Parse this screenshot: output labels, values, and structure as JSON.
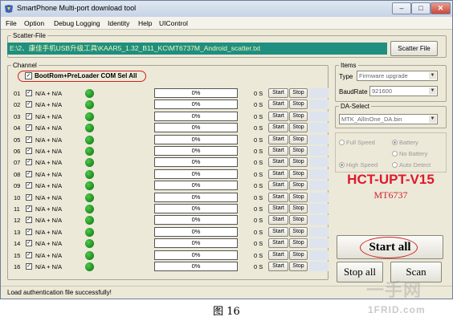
{
  "window": {
    "title": "SmartPhone Multi-port download tool",
    "minimize": "–",
    "maximize": "□",
    "close": "✕"
  },
  "menu": [
    "File",
    "Option",
    "Debug Logging",
    "Identity",
    "Help",
    "UIControl"
  ],
  "scatter": {
    "legend": "Scatter-File",
    "path": "E:\\2、康佳手机USB升级工具\\KAAR5_1.32_B11_KC\\MT6737M_Android_scatter.txt",
    "button": "Scatter File"
  },
  "channel": {
    "legend": "Channel",
    "bootrom_label": "BootRom+PreLoader COM Sel All",
    "bootrom_checked": true,
    "rows": [
      {
        "num": "01",
        "port": "N/A + N/A",
        "progress": "0%",
        "time": "0 S",
        "start": "Start",
        "stop": "Stop"
      },
      {
        "num": "02",
        "port": "N/A + N/A",
        "progress": "0%",
        "time": "0 S",
        "start": "Start",
        "stop": "Stop"
      },
      {
        "num": "03",
        "port": "N/A + N/A",
        "progress": "0%",
        "time": "0 S",
        "start": "Start",
        "stop": "Stop"
      },
      {
        "num": "04",
        "port": "N/A + N/A",
        "progress": "0%",
        "time": "0 S",
        "start": "Start",
        "stop": "Stop"
      },
      {
        "num": "05",
        "port": "N/A + N/A",
        "progress": "0%",
        "time": "0 S",
        "start": "Start",
        "stop": "Stop"
      },
      {
        "num": "06",
        "port": "N/A + N/A",
        "progress": "0%",
        "time": "0 S",
        "start": "Start",
        "stop": "Stop"
      },
      {
        "num": "07",
        "port": "N/A + N/A",
        "progress": "0%",
        "time": "0 S",
        "start": "Start",
        "stop": "Stop"
      },
      {
        "num": "08",
        "port": "N/A + N/A",
        "progress": "0%",
        "time": "0 S",
        "start": "Start",
        "stop": "Stop"
      },
      {
        "num": "09",
        "port": "N/A + N/A",
        "progress": "0%",
        "time": "0 S",
        "start": "Start",
        "stop": "Stop"
      },
      {
        "num": "10",
        "port": "N/A + N/A",
        "progress": "0%",
        "time": "0 S",
        "start": "Start",
        "stop": "Stop"
      },
      {
        "num": "11",
        "port": "N/A + N/A",
        "progress": "0%",
        "time": "0 S",
        "start": "Start",
        "stop": "Stop"
      },
      {
        "num": "12",
        "port": "N/A + N/A",
        "progress": "0%",
        "time": "0 S",
        "start": "Start",
        "stop": "Stop"
      },
      {
        "num": "13",
        "port": "N/A + N/A",
        "progress": "0%",
        "time": "0 S",
        "start": "Start",
        "stop": "Stop"
      },
      {
        "num": "14",
        "port": "N/A + N/A",
        "progress": "0%",
        "time": "0 S",
        "start": "Start",
        "stop": "Stop"
      },
      {
        "num": "15",
        "port": "N/A + N/A",
        "progress": "0%",
        "time": "0 S",
        "start": "Start",
        "stop": "Stop"
      },
      {
        "num": "16",
        "port": "N/A + N/A",
        "progress": "0%",
        "time": "0 S",
        "start": "Start",
        "stop": "Stop"
      }
    ]
  },
  "items": {
    "legend": "Items",
    "type_label": "Type",
    "type_value": "Firmware upgrade",
    "baud_label": "BaudRate",
    "baud_value": "921600"
  },
  "da": {
    "legend": "DA-Select",
    "value": "MTK_AllInOne_DA.bin"
  },
  "options": {
    "full_speed": "Full Speed",
    "high_speed": "High Speed",
    "battery": "Battery",
    "no_battery": "No Battery",
    "auto_detect": "Auto Detect"
  },
  "brand": {
    "title": "HCT-UPT-V15",
    "model": "MT6737"
  },
  "actions": {
    "start_all": "Start all",
    "stop_all": "Stop all",
    "scan": "Scan"
  },
  "status": "Load authentication file successfully!",
  "caption": "图 16",
  "watermark": {
    "logo": "一手网",
    "url": "1FRID.com"
  },
  "colors": {
    "scatter_bg": "#1f8f80",
    "scatter_text": "#f4f9b5",
    "brand_red": "#e0182b",
    "annotation_red": "#d32020",
    "led_green": "#1a9a1a"
  }
}
